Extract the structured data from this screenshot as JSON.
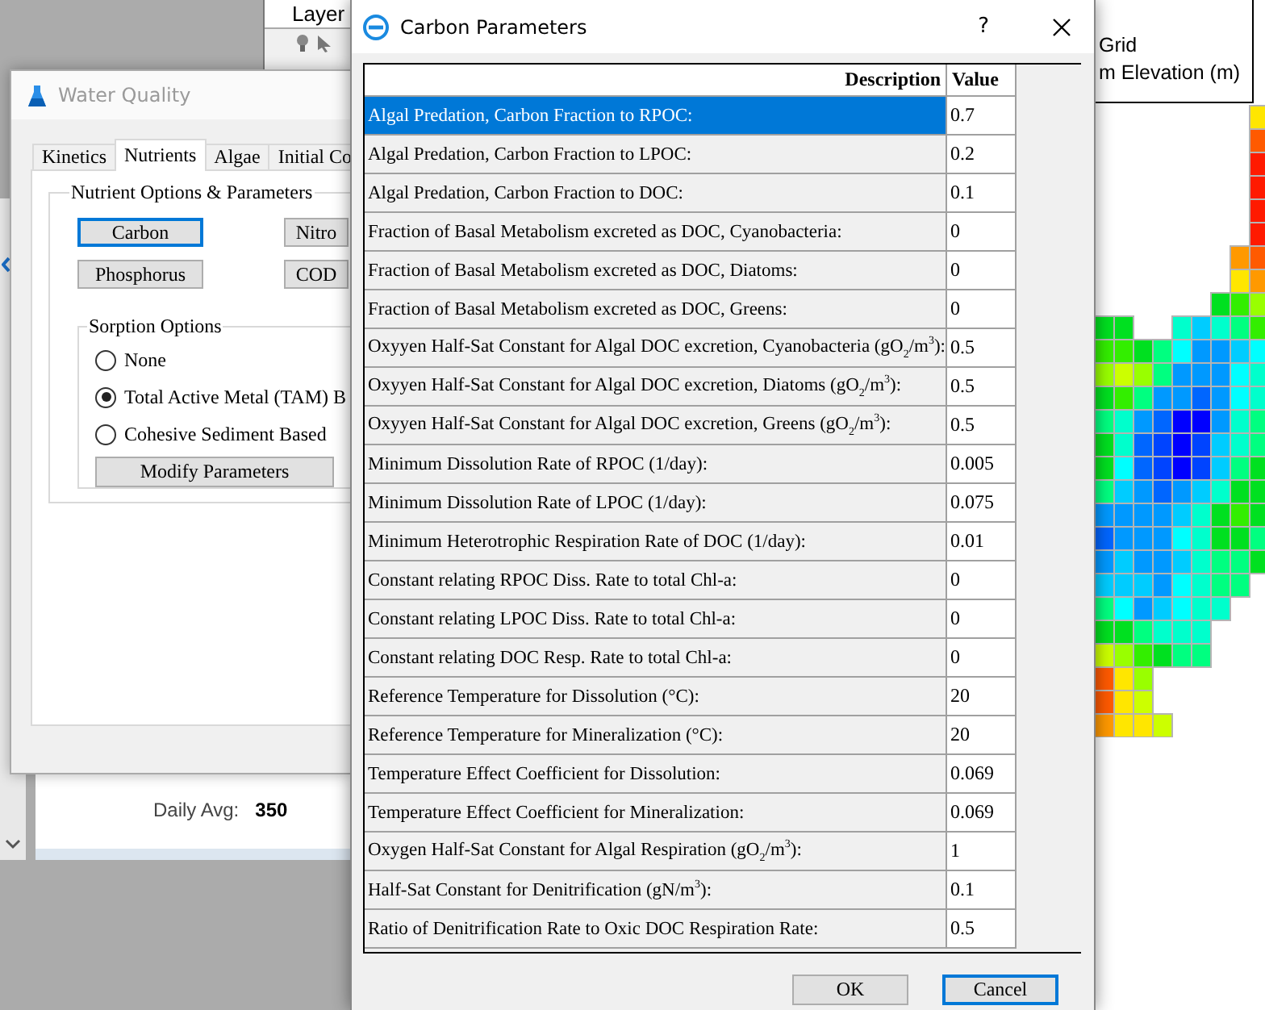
{
  "background_app": {
    "layer_panel": {
      "title": "Layer"
    },
    "legend": [
      "Grid",
      "m Elevation (m)"
    ],
    "daily_avg": {
      "label": "Daily Avg:",
      "value": "350"
    }
  },
  "water_quality": {
    "title": "Water Quality",
    "active": false,
    "tabs": [
      {
        "label": "Kinetics",
        "selected": false
      },
      {
        "label": "Nutrients",
        "selected": true
      },
      {
        "label": "Algae",
        "selected": false
      },
      {
        "label": "Initial Co",
        "selected": false
      }
    ],
    "group_title": "Nutrient Options & Parameters",
    "buttons": [
      {
        "label": "Carbon",
        "focused": true
      },
      {
        "label": "Nitro",
        "focused": false
      },
      {
        "label": "Phosphorus",
        "focused": false
      },
      {
        "label": "COD",
        "focused": false
      }
    ],
    "sorption": {
      "title": "Sorption Options",
      "options": [
        {
          "label": "None",
          "selected": false
        },
        {
          "label": "Total Active Metal (TAM) B",
          "selected": true
        },
        {
          "label": "Cohesive Sediment Based",
          "selected": false
        }
      ],
      "button": "Modify Parameters"
    }
  },
  "carbon_dialog": {
    "title": "Carbon Parameters",
    "help": "?",
    "columns": [
      "Description",
      "Value"
    ],
    "rows": [
      {
        "description": "Algal Predation, Carbon Fraction to RPOC:",
        "value": "0.7",
        "selected": true
      },
      {
        "description": "Algal Predation, Carbon Fraction to LPOC:",
        "value": "0.2",
        "selected": false
      },
      {
        "description": "Algal Predation, Carbon Fraction to  DOC:",
        "value": "0.1",
        "selected": false
      },
      {
        "description": "Fraction of Basal Metabolism excreted as DOC, Cyanobacteria:",
        "value": "0",
        "selected": false
      },
      {
        "description": "Fraction of Basal Metabolism excreted as DOC, Diatoms:",
        "value": "0",
        "selected": false
      },
      {
        "description": "Fraction of Basal Metabolism excreted as DOC, Greens:",
        "value": "0",
        "selected": false
      },
      {
        "description": "Oxyyen Half-Sat Constant for Algal DOC excretion, Cyanobacteria (gO$_{2}$/m$^{3}$):",
        "value": "0.5",
        "selected": false
      },
      {
        "description": "Oxyyen Half-Sat Constant for Algal DOC excretion, Diatoms (gO$_{2}$/m$^{3}$):",
        "value": "0.5",
        "selected": false
      },
      {
        "description": "Oxyyen Half-Sat Constant for Algal DOC excretion, Greens (gO$_{2}$/m$^{3}$):",
        "value": "0.5",
        "selected": false
      },
      {
        "description": "Minimum Dissolution Rate of RPOC (1/day):",
        "value": "0.005",
        "selected": false
      },
      {
        "description": "Minimum Dissolution Rate of LPOC (1/day):",
        "value": "0.075",
        "selected": false
      },
      {
        "description": "Minimum Heterotrophic Respiration Rate of DOC (1/day):",
        "value": "0.01",
        "selected": false
      },
      {
        "description": "Constant relating RPOC Diss. Rate to total Chl-a:",
        "value": "0",
        "selected": false
      },
      {
        "description": "Constant relating LPOC Diss. Rate to total Chl-a:",
        "value": "0",
        "selected": false
      },
      {
        "description": "Constant relating  DOC Resp. Rate to total Chl-a:",
        "value": "0",
        "selected": false
      },
      {
        "description": "Reference Temperature for Dissolution (°C):",
        "value": "20",
        "selected": false
      },
      {
        "description": "Reference Temperature for Mineralization (°C):",
        "value": "20",
        "selected": false
      },
      {
        "description": "Temperature Effect Coefficient for Dissolution:",
        "value": "0.069",
        "selected": false
      },
      {
        "description": "Temperature Effect Coefficient for Mineralization:",
        "value": "0.069",
        "selected": false
      },
      {
        "description": "Oxygen Half-Sat Constant for Algal Respiration (gO$_{2}$/m$^{3}$):",
        "value": "1",
        "selected": false
      },
      {
        "description": "Half-Sat Constant for Denitrification (gN/m$^{3}$):",
        "value": "0.1",
        "selected": false
      },
      {
        "description": "Ratio of Denitrification Rate to Oxic DOC Respiration Rate:",
        "value": "0.5",
        "selected": false
      }
    ],
    "buttons": [
      {
        "label": "OK",
        "focused": false
      },
      {
        "label": "Cancel",
        "focused": true
      }
    ]
  }
}
